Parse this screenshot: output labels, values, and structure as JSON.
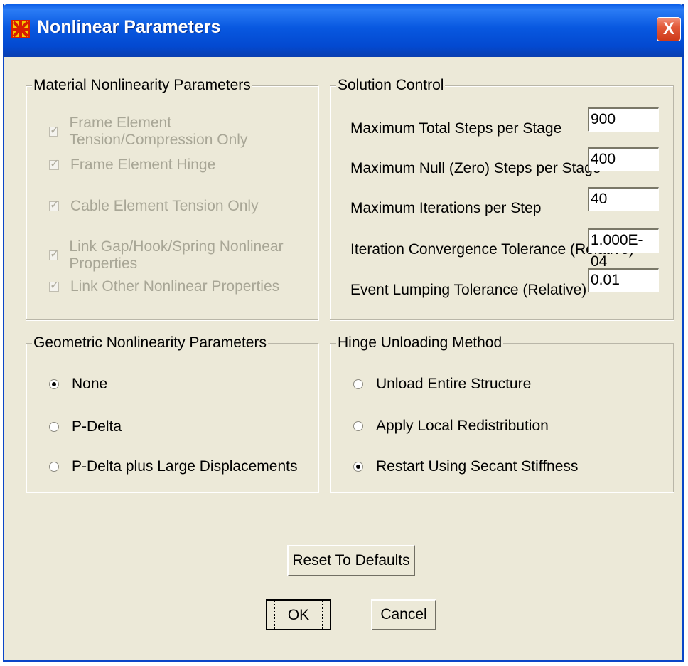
{
  "window": {
    "title": "Nonlinear Parameters",
    "close_glyph": "X"
  },
  "material": {
    "title": "Material Nonlinearity Parameters",
    "items": [
      {
        "label": "Frame Element Tension/Compression Only",
        "checked": true
      },
      {
        "label": "Frame Element Hinge",
        "checked": true
      },
      {
        "label": "Cable Element Tension Only",
        "checked": true
      },
      {
        "label": "Link Gap/Hook/Spring Nonlinear Properties",
        "checked": true
      },
      {
        "label": "Link Other Nonlinear Properties",
        "checked": true
      }
    ]
  },
  "solution": {
    "title": "Solution Control",
    "fields": [
      {
        "label": "Maximum Total Steps per Stage",
        "value": "900"
      },
      {
        "label": "Maximum Null (Zero) Steps per Stage",
        "value": "400"
      },
      {
        "label": "Maximum Iterations per Step",
        "value": "40"
      },
      {
        "label": "Iteration Convergence Tolerance (Relative)",
        "value": "1.000E-04"
      },
      {
        "label": "Event Lumping Tolerance (Relative)",
        "value": "0.01"
      }
    ]
  },
  "geometric": {
    "title": "Geometric Nonlinearity Parameters",
    "options": [
      {
        "label": "None",
        "selected": true
      },
      {
        "label": "P-Delta",
        "selected": false
      },
      {
        "label": "P-Delta plus Large Displacements",
        "selected": false
      }
    ]
  },
  "hinge": {
    "title": "Hinge Unloading Method",
    "options": [
      {
        "label": "Unload Entire Structure",
        "selected": false
      },
      {
        "label": "Apply Local Redistribution",
        "selected": false
      },
      {
        "label": "Restart Using Secant Stiffness",
        "selected": true
      }
    ]
  },
  "buttons": {
    "reset": "Reset To Defaults",
    "ok": "OK",
    "cancel": "Cancel"
  },
  "colors": {
    "titlebar": "#0a58e0",
    "dialog_bg": "#ece9d8",
    "close": "#e25a3a"
  }
}
